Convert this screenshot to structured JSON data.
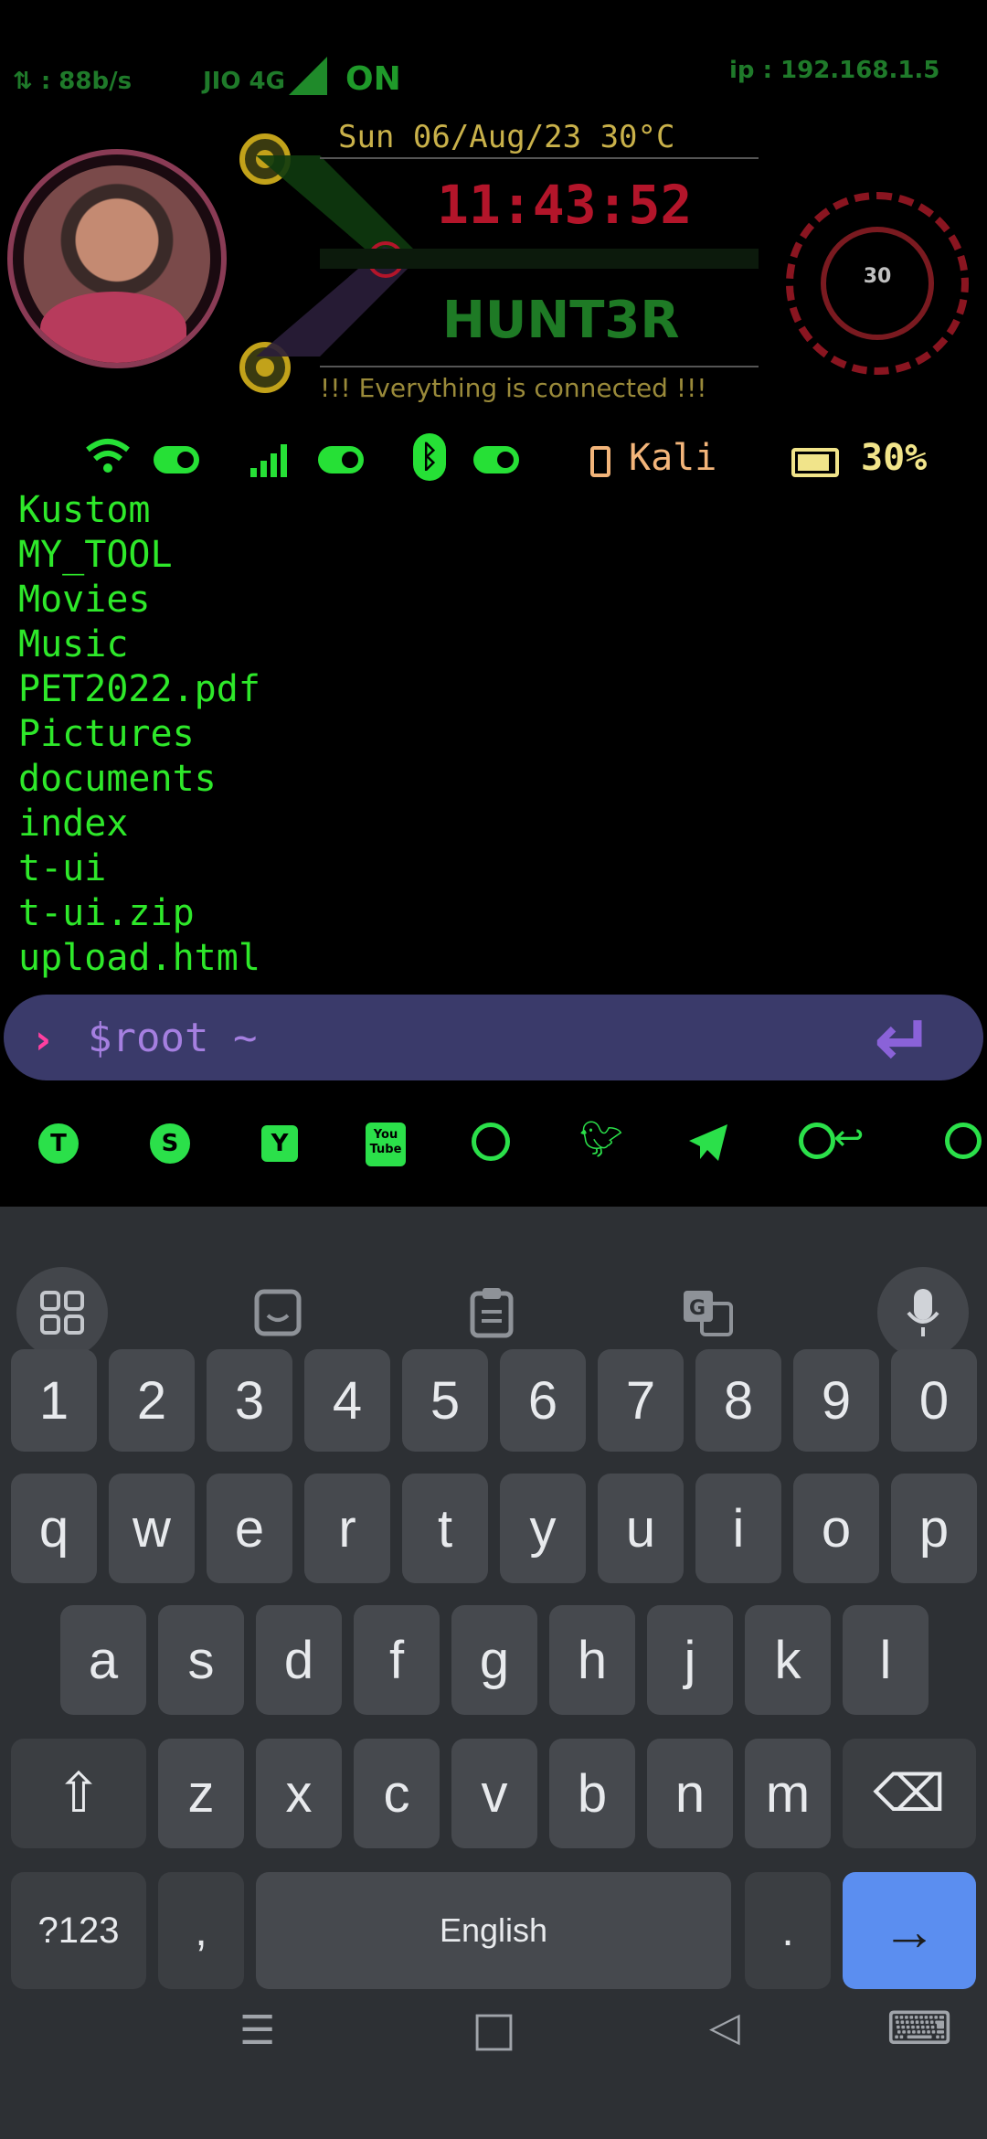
{
  "status": {
    "speed": "⇅ : 88b/s",
    "network": "JIO 4G",
    "network_state": "ON",
    "ip": "ip : 192.168.1.5"
  },
  "header": {
    "date": "Sun 06/Aug/23 30°C",
    "clock": "11:43:52",
    "name": "HUNT3R",
    "message": "!!! Everything is connected !!!",
    "gauge_value": "30"
  },
  "toggles": {
    "wifi_icon": "wifi-icon",
    "cellular_icon": "cellular-icon",
    "bluetooth_icon": "bluetooth-icon",
    "device_label": "Kali",
    "battery_percent": "30%"
  },
  "terminal": {
    "lines": [
      "Kustom",
      "MY_TOOL",
      "Movies",
      "Music",
      "PET2022.pdf",
      "Pictures",
      "documents",
      "index",
      "t-ui",
      "t-ui.zip",
      "upload.html"
    ],
    "prompt_symbol": "›",
    "prompt": "$root  ~",
    "enter_symbol": "↵"
  },
  "apps": [
    "T",
    "S",
    "Y",
    "You Tube",
    "WhatsApp",
    "Twitter",
    "Telegram",
    "WhatsApp Reply",
    "WhatsApp"
  ],
  "keyboard": {
    "toolbar": [
      "apps-grid-icon",
      "sticker-icon",
      "clipboard-icon",
      "translate-icon",
      "mic-icon"
    ],
    "row_numbers": [
      "1",
      "2",
      "3",
      "4",
      "5",
      "6",
      "7",
      "8",
      "9",
      "0"
    ],
    "row_q": [
      "q",
      "w",
      "e",
      "r",
      "t",
      "y",
      "u",
      "i",
      "o",
      "p"
    ],
    "row_a": [
      "a",
      "s",
      "d",
      "f",
      "g",
      "h",
      "j",
      "k",
      "l"
    ],
    "row_z": [
      "z",
      "x",
      "c",
      "v",
      "b",
      "n",
      "m"
    ],
    "symbols_key": "?123",
    "comma_key": ",",
    "space_key": "English",
    "period_key": ".",
    "enter_key": "→",
    "shift_key": "⇧",
    "backspace_key": "⌫"
  },
  "navbar": {
    "menu_icon": "☰",
    "home_icon": "□",
    "back_icon": "◁",
    "keyboard_icon": "⌨"
  },
  "colors": {
    "terminal_green": "#2ee82a",
    "clock_red": "#b3152a",
    "prompt_bar": "#3a3a6a",
    "enter_blue": "#5b8ef0"
  }
}
